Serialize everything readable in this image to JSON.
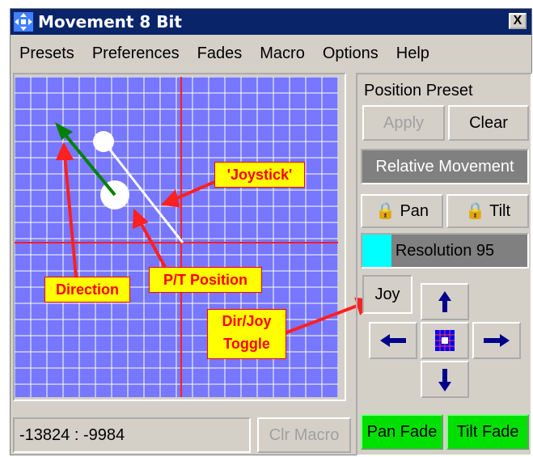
{
  "window": {
    "title": "Movement 8 Bit",
    "close_label": "X"
  },
  "menu": [
    "Presets",
    "Preferences",
    "Fades",
    "Macro",
    "Options",
    "Help"
  ],
  "position_preset": {
    "label": "Position Preset",
    "apply": "Apply",
    "clear": "Clear"
  },
  "relative_movement": "Relative Movement",
  "pan_lock": "Pan",
  "tilt_lock": "Tilt",
  "resolution": {
    "label": "Resolution 95",
    "value": 95
  },
  "joy_toggle": "Joy",
  "coordinates": "-13824 : -9984",
  "clr_macro": "Clr Macro",
  "pan_fade": "Pan Fade",
  "tilt_fade": "Tilt Fade",
  "annotations": {
    "joystick": "'Joystick'",
    "pt_position": "P/T Position",
    "direction": "Direction",
    "dir_joy_line1": "Dir/Joy",
    "dir_joy_line2": "Toggle"
  },
  "colors": {
    "grid_bg": "#7777ff",
    "grid_line": "#ffffff",
    "axis": "#ff0000",
    "direction_arrow": "#008000",
    "callout_bg": "#ffff00",
    "fade_bg": "#00e000",
    "resolution_fill": "#00ffff",
    "title_bar": "#0a246a"
  },
  "icons": [
    "move-icon",
    "lock-icon",
    "arrow-up-icon",
    "arrow-down-icon",
    "arrow-left-icon",
    "arrow-right-icon",
    "center-grid-icon"
  ]
}
